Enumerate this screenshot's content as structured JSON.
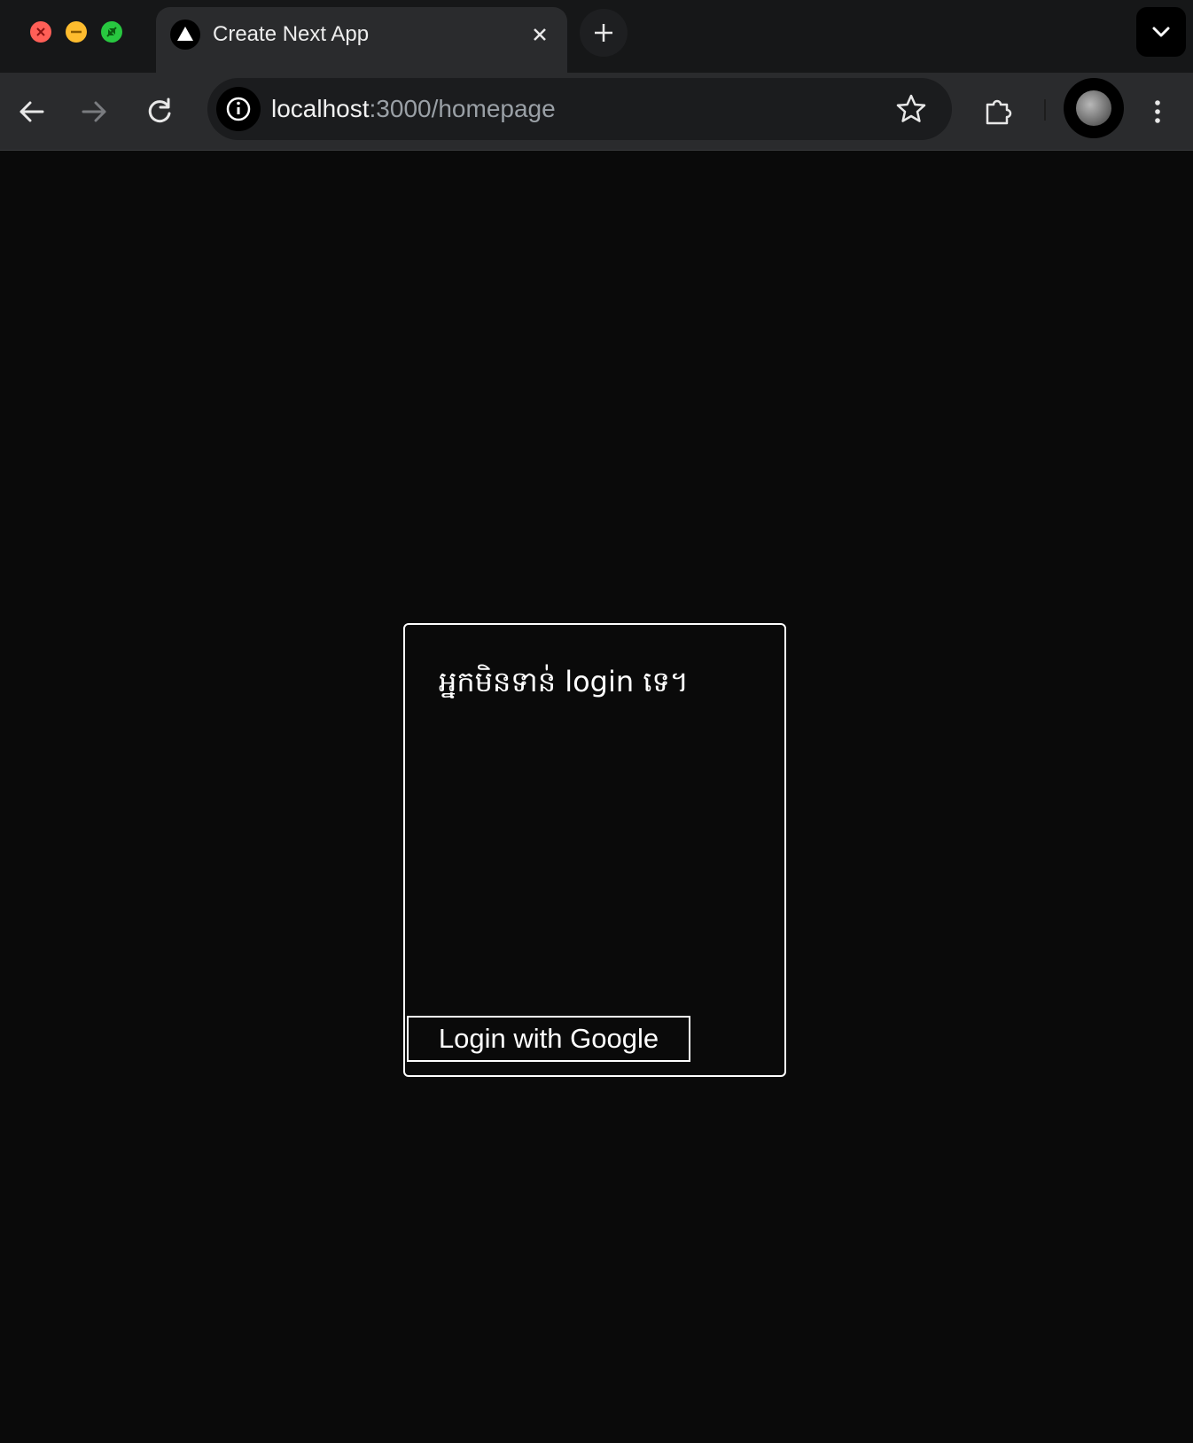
{
  "browser": {
    "tab": {
      "title": "Create Next App",
      "favicon_icon": "triangle-icon"
    },
    "address_bar": {
      "host": "localhost",
      "path": ":3000/homepage"
    }
  },
  "page": {
    "message": "អ្នកមិនទាន់ login ទេ។",
    "login_button_label": "Login with Google"
  },
  "colors": {
    "background": "#0a0a0a",
    "foreground": "#ffffff",
    "chrome_bar": "#2a2b2d",
    "tabstrip": "#161718"
  }
}
